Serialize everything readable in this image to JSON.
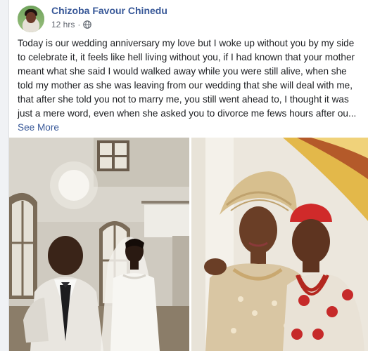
{
  "post": {
    "author": "Chizoba Favour Chinedu",
    "timestamp": "12 hrs",
    "separator": "·",
    "audience_icon": "globe-icon",
    "text": "Today is our wedding anniversary my love but I woke up without you by my side to celebrate it, it feels like hell living without you, if I had known that your mother meant what she said I would walked away while you were still alive, when she told my mother as she was leaving from our wedding that she will deal with me, that after she told you not to marry me, you still went ahead to, I thought it was just a mere word, even when she asked you to divorce me fews hours after ou...",
    "see_more": "See More"
  },
  "colors": {
    "author_link": "#385898",
    "text": "#1c1e21",
    "meta": "#616770",
    "background": "#ffffff"
  }
}
